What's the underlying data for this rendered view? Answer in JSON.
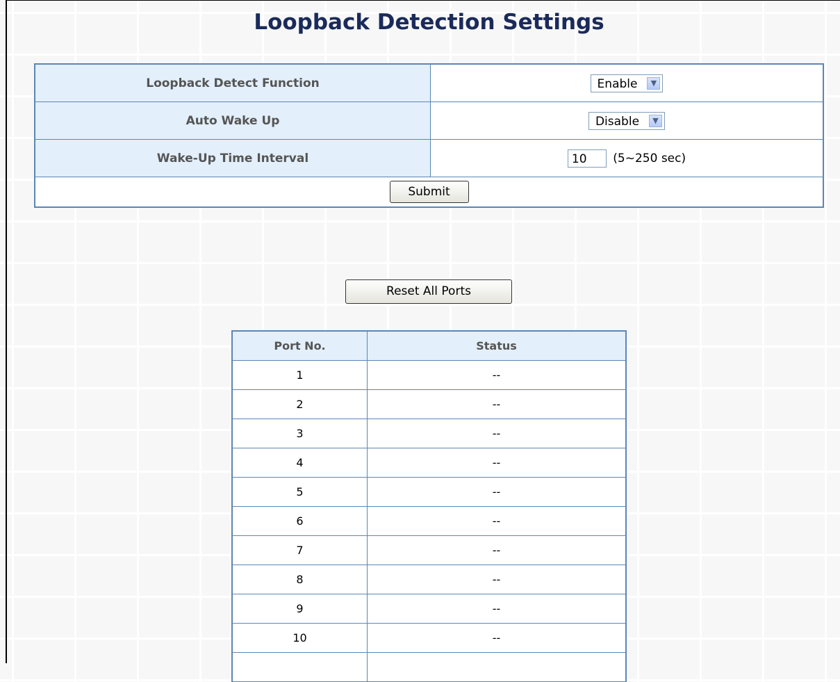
{
  "page": {
    "title": "Loopback Detection Settings"
  },
  "settings": {
    "loopback_detect": {
      "label": "Loopback Detect Function",
      "value": "Enable"
    },
    "auto_wake_up": {
      "label": "Auto Wake Up",
      "value": "Disable"
    },
    "wake_interval": {
      "label": "Wake-Up Time Interval",
      "value": "10",
      "unit": "(5~250 sec)"
    },
    "submit_label": "Submit"
  },
  "reset_label": "Reset All Ports",
  "ports_table": {
    "headers": [
      "Port No.",
      "Status"
    ],
    "rows": [
      [
        "1",
        "--"
      ],
      [
        "2",
        "--"
      ],
      [
        "3",
        "--"
      ],
      [
        "4",
        "--"
      ],
      [
        "5",
        "--"
      ],
      [
        "6",
        "--"
      ],
      [
        "7",
        "--"
      ],
      [
        "8",
        "--"
      ],
      [
        "9",
        "--"
      ],
      [
        "10",
        "--"
      ],
      [
        "",
        ""
      ]
    ]
  },
  "icons": {
    "dropdown": "chevron-down-icon"
  },
  "colors": {
    "title": "#1a2a5a",
    "label_bg": "#e3effa",
    "border": "#5b86b5"
  }
}
